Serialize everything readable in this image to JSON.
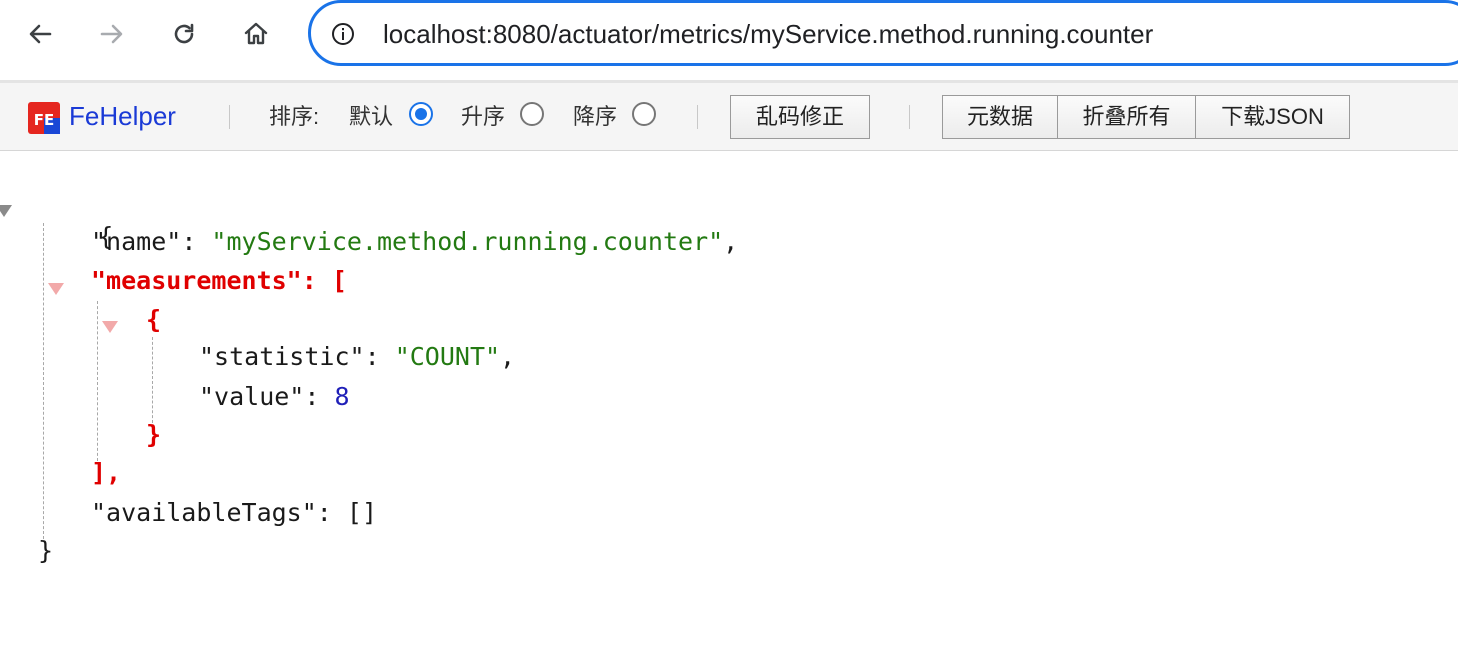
{
  "browser": {
    "url": "localhost:8080/actuator/metrics/myService.method.running.counter",
    "icons": [
      "back-arrow-icon",
      "forward-arrow-icon",
      "reload-icon",
      "home-icon",
      "site-info-icon"
    ]
  },
  "toolbar": {
    "brand": "FeHelper",
    "logo_text": "FE",
    "sort_label": "排序:",
    "sort_options": [
      {
        "label": "默认",
        "checked": true
      },
      {
        "label": "升序",
        "checked": false
      },
      {
        "label": "降序",
        "checked": false
      }
    ],
    "fix_encoding_label": "乱码修正",
    "metadata_label": "元数据",
    "collapse_all_label": "折叠所有",
    "download_json_label": "下载JSON"
  },
  "json_view": {
    "open_brace": "{",
    "close_brace": "}",
    "name_key": "\"name\"",
    "name_value": "\"myService.method.running.counter\"",
    "measurements_key": "\"measurements\"",
    "array_open": "[",
    "array_close": "],",
    "object_open": "{",
    "object_close": "}",
    "statistic_key": "\"statistic\"",
    "statistic_value": "\"COUNT\"",
    "value_key": "\"value\"",
    "value_value": "8",
    "available_tags_key": "\"availableTags\"",
    "available_tags_value": "[]",
    "colon": ": ",
    "comma": ","
  },
  "colors": {
    "omnibox_border": "#1a73e8",
    "brand": "#1a3ad6",
    "string": "#237a12",
    "number": "#1f1fb8",
    "highlight": "#e00000"
  }
}
